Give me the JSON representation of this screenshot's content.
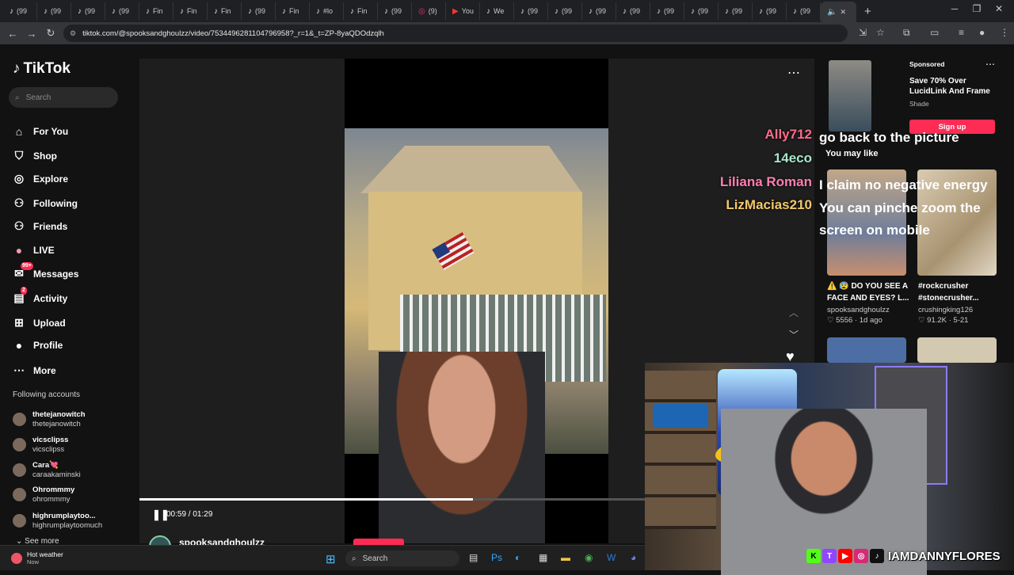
{
  "browser": {
    "tabs": [
      {
        "icon": "tiktok-icon",
        "label": "(99"
      },
      {
        "icon": "tiktok-icon",
        "label": "(99"
      },
      {
        "icon": "tiktok-icon",
        "label": "(99"
      },
      {
        "icon": "tiktok-icon",
        "label": "(99"
      },
      {
        "icon": "tiktok-icon",
        "label": "Fin"
      },
      {
        "icon": "tiktok-icon",
        "label": "Fin"
      },
      {
        "icon": "tiktok-icon",
        "label": "Fin"
      },
      {
        "icon": "tiktok-icon",
        "label": "(99"
      },
      {
        "icon": "tiktok-icon",
        "label": "Fin"
      },
      {
        "icon": "tiktok-icon",
        "label": "#lo"
      },
      {
        "icon": "tiktok-icon",
        "label": "Fin"
      },
      {
        "icon": "tiktok-icon",
        "label": "(99"
      },
      {
        "icon": "instagram-icon",
        "label": "(9)"
      },
      {
        "icon": "youtube-icon",
        "label": "You"
      },
      {
        "icon": "tiktok-icon",
        "label": "We"
      },
      {
        "icon": "tiktok-icon",
        "label": "(99"
      },
      {
        "icon": "tiktok-icon",
        "label": "(99"
      },
      {
        "icon": "tiktok-icon",
        "label": "(99"
      },
      {
        "icon": "tiktok-icon",
        "label": "(99"
      },
      {
        "icon": "tiktok-icon",
        "label": "(99"
      },
      {
        "icon": "tiktok-icon",
        "label": "(99"
      },
      {
        "icon": "tiktok-icon",
        "label": "(99"
      },
      {
        "icon": "tiktok-icon",
        "label": "(99"
      },
      {
        "icon": "tiktok-icon",
        "label": "(99"
      }
    ],
    "url": "tiktok.com/@spooksandghoulzz/video/7534496281104796958?_r=1&_t=ZP-8yaQDOdzqlh"
  },
  "sidebar": {
    "logo": "TikTok",
    "search_placeholder": "Search",
    "nav": [
      {
        "label": "For You",
        "icon": "home-icon"
      },
      {
        "label": "Shop",
        "icon": "shop-icon"
      },
      {
        "label": "Explore",
        "icon": "compass-icon"
      },
      {
        "label": "Following",
        "icon": "following-icon"
      },
      {
        "label": "Friends",
        "icon": "friends-icon"
      },
      {
        "label": "LIVE",
        "icon": "live-icon"
      },
      {
        "label": "Messages",
        "icon": "messages-icon",
        "badge": "99+"
      },
      {
        "label": "Activity",
        "icon": "activity-icon",
        "badge": "2"
      },
      {
        "label": "Upload",
        "icon": "upload-icon"
      },
      {
        "label": "Profile",
        "icon": "profile-icon"
      },
      {
        "label": "More",
        "icon": "more-icon"
      }
    ],
    "following_title": "Following accounts",
    "accounts": [
      {
        "name": "thetejanowitch",
        "handle": "thetejanowitch"
      },
      {
        "name": "vicsclipss",
        "handle": "vicsclipss"
      },
      {
        "name": "Cara💘",
        "handle": "caraakaminski"
      },
      {
        "name": "Ohrommmy",
        "handle": "ohrommmy"
      },
      {
        "name": "highrumplaytoo...",
        "handle": "highrumplaytoomuch"
      }
    ],
    "see_more": "See more"
  },
  "player": {
    "time": "00:59 / 01:29",
    "progress": 0.66,
    "author": "spooksandghoulzz"
  },
  "ad": {
    "sponsored": "Sponsored",
    "title": "Save 70% Over LucidLink And Frame",
    "brand": "Shade",
    "signup": "Sign up"
  },
  "suggested": {
    "title": "You may like",
    "cards": [
      {
        "title": "⚠️ 😰 DO YOU SEE A FACE AND EYES? L...",
        "user": "spooksandghoulzz",
        "stats": "♡ 5556 · 1d ago"
      },
      {
        "title": "#rockcrusher #stonecrusher...",
        "user": "crushingking126",
        "stats": "♡ 91.2K · 5-21"
      }
    ]
  },
  "chat": [
    {
      "user": "Ally712",
      "message": "go back to the picture",
      "color": "#ff6b8a"
    },
    {
      "user": "14eco",
      "message": "",
      "color": "#a8e6c8"
    },
    {
      "user": "Liliana Roman",
      "message": "I claim no negative energy",
      "color": "#ff7fb0"
    },
    {
      "user": "LizMacias210",
      "message": "You can pinche zoom the screen on mobile",
      "color": "#f2c86b"
    }
  ],
  "stream": {
    "handle": "IAMDANNYFLORES",
    "socials": [
      {
        "icon": "kick-icon",
        "color": "#53fc18",
        "glyph": "K"
      },
      {
        "icon": "twitch-icon",
        "color": "#9146ff",
        "glyph": "T"
      },
      {
        "icon": "youtube-icon",
        "color": "#ff0000",
        "glyph": "▶"
      },
      {
        "icon": "instagram-icon",
        "color": "#d62976",
        "glyph": "◎"
      },
      {
        "icon": "tiktok-icon",
        "color": "#111111",
        "glyph": "♪"
      }
    ]
  },
  "taskbar": {
    "weather_title": "Hot weather",
    "weather_sub": "Now",
    "search": "Search"
  }
}
